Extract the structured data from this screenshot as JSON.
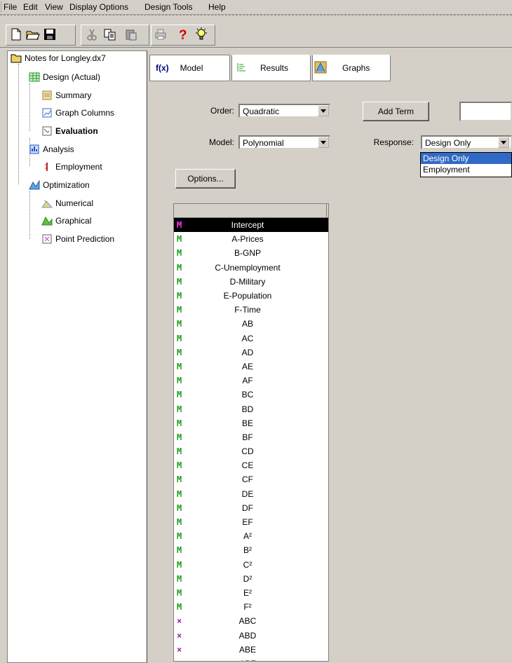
{
  "menu": [
    "File",
    "Edit",
    "View",
    "Display Options",
    "Design Tools",
    "Help"
  ],
  "toolbar": {
    "buttons": [
      "new-file-icon",
      "open-folder-icon",
      "save-disk-icon",
      "cut-scissors-icon",
      "copy-icon",
      "paste-icon",
      "print-icon",
      "help-question-icon",
      "tip-lightbulb-icon"
    ]
  },
  "tree": {
    "root": "Notes for Longley.dx7",
    "items": [
      {
        "label": "Design (Actual)",
        "icon": "design-grid-icon"
      },
      {
        "label": "Summary",
        "icon": "summary-icon"
      },
      {
        "label": "Graph Columns",
        "icon": "graph-columns-icon"
      },
      {
        "label": "Evaluation",
        "icon": "evaluation-icon",
        "bold": true
      },
      {
        "label": "Analysis",
        "icon": "analysis-icon"
      },
      {
        "label": "Employment",
        "icon": "employment-icon"
      },
      {
        "label": "Optimization",
        "icon": "optimization-icon"
      },
      {
        "label": "Numerical",
        "icon": "numerical-icon"
      },
      {
        "label": "Graphical",
        "icon": "graphical-icon"
      },
      {
        "label": "Point Prediction",
        "icon": "point-prediction-icon"
      }
    ]
  },
  "tabs": [
    {
      "icon": "f(x)",
      "label": "Model"
    },
    {
      "icon": "results-icon",
      "label": "Results"
    },
    {
      "icon": "graphs-icon",
      "label": "Graphs"
    }
  ],
  "form": {
    "order_label": "Order:",
    "order_value": "Quadratic",
    "model_label": "Model:",
    "model_value": "Polynomial",
    "add_term": "Add Term",
    "response_label": "Response:",
    "response_value": "Design Only",
    "response_options": [
      "Design Only",
      "Employment"
    ],
    "options_button": "Options..."
  },
  "terms": [
    {
      "mark": "M",
      "name": "Intercept",
      "type": "m",
      "highlight": true
    },
    {
      "mark": "M",
      "name": "A-Prices",
      "type": "m"
    },
    {
      "mark": "M",
      "name": "B-GNP",
      "type": "m"
    },
    {
      "mark": "M",
      "name": "C-Unemployment",
      "type": "m"
    },
    {
      "mark": "M",
      "name": "D-Military",
      "type": "m"
    },
    {
      "mark": "M",
      "name": "E-Population",
      "type": "m"
    },
    {
      "mark": "M",
      "name": "F-Time",
      "type": "m"
    },
    {
      "mark": "M",
      "name": "AB",
      "type": "m"
    },
    {
      "mark": "M",
      "name": "AC",
      "type": "m"
    },
    {
      "mark": "M",
      "name": "AD",
      "type": "m"
    },
    {
      "mark": "M",
      "name": "AE",
      "type": "m"
    },
    {
      "mark": "M",
      "name": "AF",
      "type": "m"
    },
    {
      "mark": "M",
      "name": "BC",
      "type": "m"
    },
    {
      "mark": "M",
      "name": "BD",
      "type": "m"
    },
    {
      "mark": "M",
      "name": "BE",
      "type": "m"
    },
    {
      "mark": "M",
      "name": "BF",
      "type": "m"
    },
    {
      "mark": "M",
      "name": "CD",
      "type": "m"
    },
    {
      "mark": "M",
      "name": "CE",
      "type": "m"
    },
    {
      "mark": "M",
      "name": "CF",
      "type": "m"
    },
    {
      "mark": "M",
      "name": "DE",
      "type": "m"
    },
    {
      "mark": "M",
      "name": "DF",
      "type": "m"
    },
    {
      "mark": "M",
      "name": "EF",
      "type": "m"
    },
    {
      "mark": "M",
      "name": "A²",
      "type": "m"
    },
    {
      "mark": "M",
      "name": "B²",
      "type": "m"
    },
    {
      "mark": "M",
      "name": "C²",
      "type": "m"
    },
    {
      "mark": "M",
      "name": "D²",
      "type": "m"
    },
    {
      "mark": "M",
      "name": "E²",
      "type": "m"
    },
    {
      "mark": "M",
      "name": "F²",
      "type": "m"
    },
    {
      "mark": "×",
      "name": "ABC",
      "type": "x"
    },
    {
      "mark": "×",
      "name": "ABD",
      "type": "x"
    },
    {
      "mark": "×",
      "name": "ABE",
      "type": "x"
    },
    {
      "mark": "×",
      "name": "ABF",
      "type": "x"
    }
  ]
}
